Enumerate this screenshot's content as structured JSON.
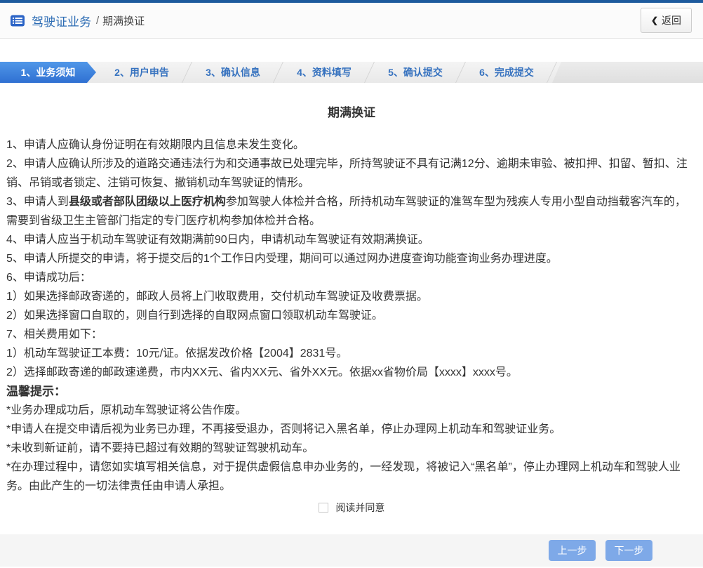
{
  "header": {
    "breadcrumb": {
      "section": "驾驶证业务",
      "separator": "/",
      "current": "期满换证"
    },
    "back_button": {
      "icon": "❮",
      "label": "返回"
    }
  },
  "steps": {
    "active_index": 0,
    "items": [
      "1、业务须知",
      "2、用户申告",
      "3、确认信息",
      "4、资料填写",
      "5、确认提交",
      "6、完成提交"
    ]
  },
  "content": {
    "title": "期满换证",
    "paragraphs": [
      "1、申请人应确认身份证明在有效期限内且信息未发生变化。",
      "2、申请人应确认所涉及的道路交通违法行为和交通事故已处理完毕，所持驾驶证不具有记满12分、逾期未审验、被扣押、扣留、暂扣、注销、吊销或者锁定、注销可恢复、撤销机动车驾驶证的情形。",
      {
        "prefix": "3、申请人到",
        "bold": "县级或者部队团级以上医疗机构",
        "suffix": "参加驾驶人体检并合格，所持机动车驾驶证的准驾车型为残疾人专用小型自动挡载客汽车的，需要到省级卫生主管部门指定的专门医疗机构参加体检并合格。"
      },
      "4、申请人应当于机动车驾驶证有效期满前90日内，申请机动车驾驶证有效期满换证。",
      "5、申请人所提交的申请，将于提交后的1个工作日内受理，期间可以通过网办进度查询功能查询业务办理进度。",
      "6、申请成功后：",
      "1）如果选择邮政寄递的，邮政人员将上门收取费用，交付机动车驾驶证及收费票据。",
      "2）如果选择窗口自取的，则自行到选择的自取网点窗口领取机动车驾驶证。",
      "7、相关费用如下：",
      "1）机动车驾驶证工本费：10元/证。依据发改价格【2004】2831号。",
      "2）选择邮政寄递的邮政速递费，市内XX元、省内XX元、省外XX元。依据xx省物价局【xxxx】xxxx号。"
    ],
    "tips_heading": "温馨提示：",
    "tips": [
      "*业务办理成功后，原机动车驾驶证将公告作废。",
      "*申请人在提交申请后视为业务已办理，不再接受退办，否则将记入黑名单，停止办理网上机动车和驾驶证业务。",
      "*未收到新证前，请不要持已超过有效期的驾驶证驾驶机动车。",
      "*在办理过程中，请您如实填写相关信息，对于提供虚假信息申办业务的，一经发现，将被记入“黑名单”，停止办理网上机动车和驾驶人业务。由此产生的一切法律责任由申请人承担。"
    ],
    "agree_label": "阅读并同意"
  },
  "footer": {
    "prev_label": "上一步",
    "next_label": "下一步"
  },
  "colors": {
    "top_bar": "#1d5a9d",
    "step_active_start": "#5097e8",
    "step_active_end": "#2f70d2",
    "step_text": "#3672bf",
    "breadcrumb_blue": "#2e6db4",
    "button_blue": "#7ea9e8",
    "body_text": "#333333"
  }
}
